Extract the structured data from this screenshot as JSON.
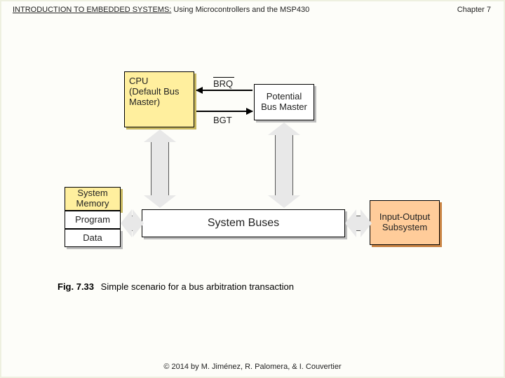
{
  "header": {
    "title_prefix": "INTRODUCTION TO EMBEDDED SYSTEMS:",
    "title_suffix": " Using Microcontrollers and the MSP430",
    "chapter": "Chapter 7"
  },
  "footer": {
    "copyright": "© 2014 by M. Jiménez, R. Palomera, & I. Couvertier"
  },
  "figure": {
    "label": "Fig. 7.33",
    "caption": "Simple scenario for a bus arbitration transaction",
    "nodes": {
      "cpu_line1": "CPU",
      "cpu_line2": "(Default Bus",
      "cpu_line3": "Master)",
      "potential_bus_master": "Potential Bus Master",
      "system_memory": "System Memory",
      "program": "Program",
      "data": "Data",
      "system_buses": "System Buses",
      "io_subsystem": "Input-Output Subsystem"
    },
    "signals": {
      "brq": "BRQ",
      "bgt": "BGT"
    }
  }
}
